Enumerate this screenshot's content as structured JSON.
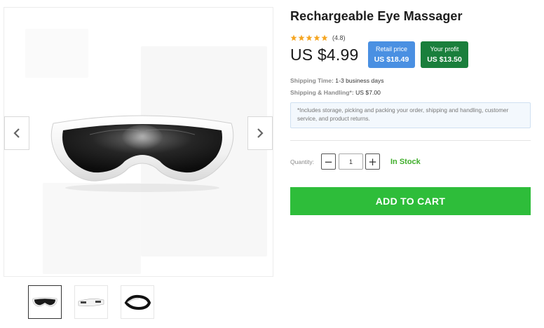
{
  "product": {
    "title": "Rechargeable Eye Massager",
    "rating_text": "(4.8)",
    "rating_value": 4.8,
    "rating_max": 5,
    "price": "US $4.99",
    "retail_label": "Retail price",
    "retail_value": "US $18.49",
    "profit_label": "Your profit",
    "profit_value": "US $13.50"
  },
  "shipping": {
    "time_label": "Shipping Time:",
    "time_value": "1-3 business days",
    "handling_label": "Shipping & Handling*:",
    "handling_value": "US $7.00",
    "note": "*Includes storage, picking and packing your order, shipping and handling, customer service, and product returns."
  },
  "quantity": {
    "label": "Quantity:",
    "value": "1",
    "minus": "−",
    "plus": "+",
    "stock_status": "In Stock"
  },
  "actions": {
    "add_to_cart": "ADD TO CART"
  },
  "gallery": {
    "prev_icon": "chevron-left-icon",
    "next_icon": "chevron-right-icon",
    "thumbnail_count": 3,
    "active_thumbnail": 1
  },
  "colors": {
    "retail_badge": "#4a90e2",
    "profit_badge": "#1a7f3c",
    "in_stock": "#3fae2a",
    "cart_button": "#2ebd3a",
    "star": "#f5a623"
  }
}
